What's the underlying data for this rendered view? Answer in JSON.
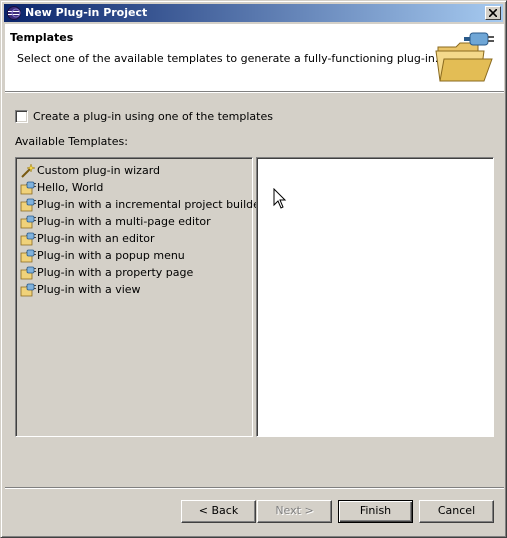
{
  "window": {
    "title": "New Plug-in Project"
  },
  "banner": {
    "title": "Templates",
    "description": "Select one of the available templates to generate a fully-functioning plug-in."
  },
  "options": {
    "use_template_label": "Create a plug-in using one of the templates",
    "use_template_checked": false
  },
  "templates": {
    "label": "Available Templates:",
    "items": [
      {
        "label": "Custom plug-in wizard",
        "icon": "wizard-icon"
      },
      {
        "label": "Hello, World",
        "icon": "plugin-template-icon"
      },
      {
        "label": "Plug-in with a incremental project builder",
        "icon": "plugin-template-icon"
      },
      {
        "label": "Plug-in with a multi-page editor",
        "icon": "plugin-template-icon"
      },
      {
        "label": "Plug-in with an editor",
        "icon": "plugin-template-icon"
      },
      {
        "label": "Plug-in with a popup menu",
        "icon": "plugin-template-icon"
      },
      {
        "label": "Plug-in with a property page",
        "icon": "plugin-template-icon"
      },
      {
        "label": "Plug-in with a view",
        "icon": "plugin-template-icon"
      }
    ]
  },
  "buttons": {
    "back": "< Back",
    "next": "Next >",
    "finish": "Finish",
    "cancel": "Cancel"
  }
}
